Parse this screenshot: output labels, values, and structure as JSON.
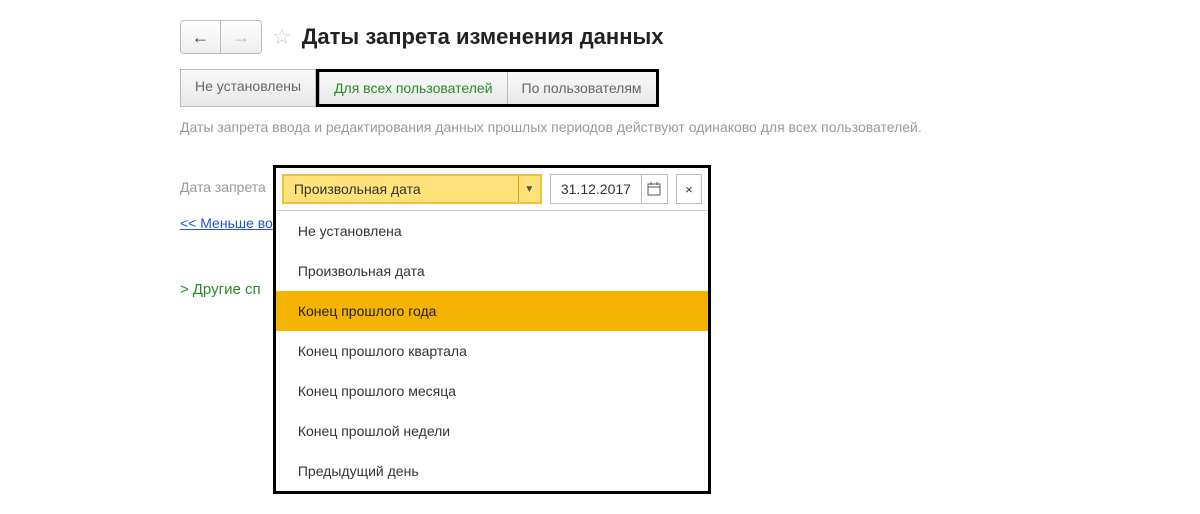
{
  "header": {
    "title": "Даты запрета изменения данных"
  },
  "tabs": {
    "not_set": "Не установлены",
    "all_users": "Для всех пользователей",
    "by_users": "По пользователям"
  },
  "description": "Даты запрета ввода и редактирования данных прошлых периодов действуют одинаково для всех пользователей.",
  "form": {
    "label": "Дата запрета",
    "selected": "Произвольная дата",
    "date_value": "31.12.2017"
  },
  "dropdown": {
    "items": [
      "Не установлена",
      "Произвольная дата",
      "Конец прошлого года",
      "Конец прошлого квартала",
      "Конец прошлого месяца",
      "Конец прошлой недели",
      "Предыдущий день"
    ],
    "highlighted_index": 2
  },
  "links": {
    "less": "<< Меньше во",
    "other": "Другие сп"
  },
  "icons": {
    "back": "←",
    "forward": "→",
    "star": "☆",
    "caret": "▼",
    "calendar": "📅",
    "clear": "×",
    "chevron": ">"
  }
}
